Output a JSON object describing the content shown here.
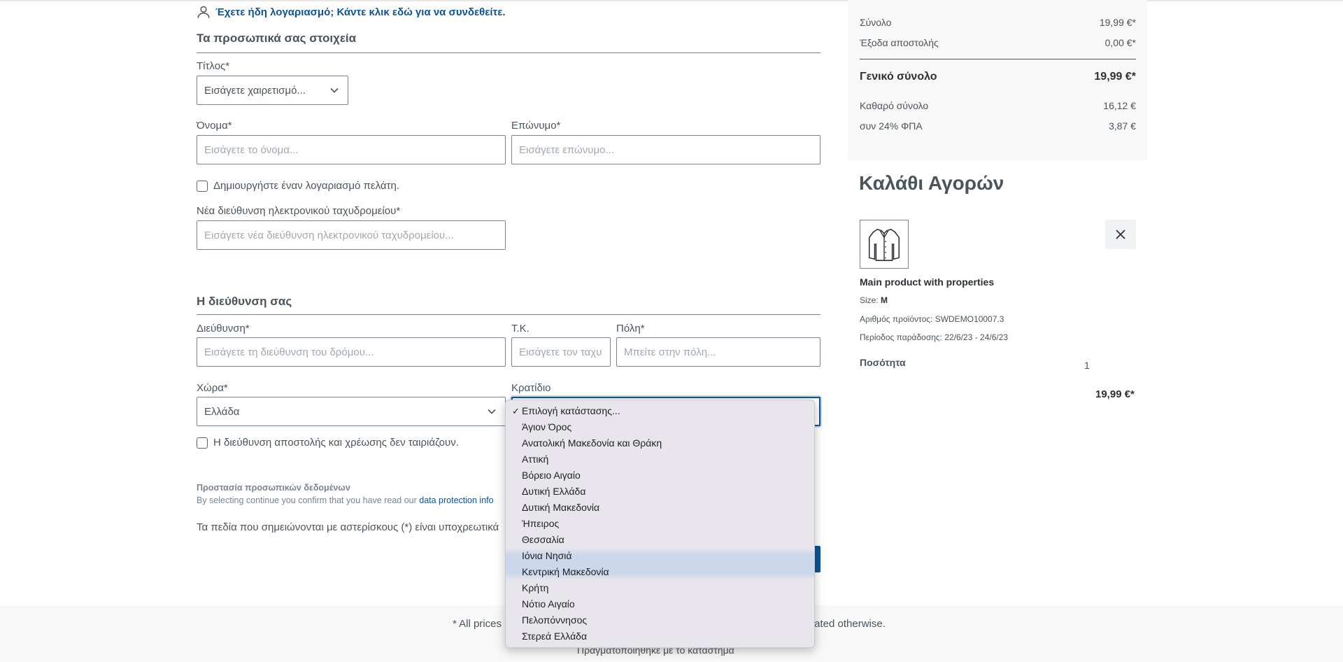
{
  "login_hint": "Έχετε ήδη λογαριασμό; Κάντε κλικ εδώ για να συνδεθείτε.",
  "personal": {
    "heading": "Τα προσωπικά σας στοιχεία",
    "title_label": "Τίτλος*",
    "title_value": "Εισάγετε χαιρετισμό...",
    "first_name_label": "Όνομα*",
    "first_name_placeholder": "Εισάγετε το όνομα...",
    "last_name_label": "Επώνυμο*",
    "last_name_placeholder": "Εισάγετε επώνυμο...",
    "create_account_label": "Δημιουργήστε έναν λογαριασμό πελάτη.",
    "email_label": "Νέα διεύθυνση ηλεκτρονικού ταχυδρομείου*",
    "email_placeholder": "Εισάγετε νέα διεύθυνση ηλεκτρονικού ταχυδρομείου..."
  },
  "address": {
    "heading": "Η διεύθυνση σας",
    "street_label": "Διεύθυνση*",
    "street_placeholder": "Εισάγετε τη διεύθυνση του δρόμου...",
    "zip_label": "Τ.Κ.",
    "zip_placeholder": "Εισάγετε τον ταχυ",
    "city_label": "Πόλη*",
    "city_placeholder": "Μπείτε στην πόλη...",
    "country_label": "Χώρα*",
    "country_value": "Ελλάδα",
    "state_label": "Κρατίδιο",
    "different_shipping_label": "Η διεύθυνση αποστολής και χρέωσης δεν ταιριάζουν."
  },
  "privacy": {
    "title": "Προστασία προσωπικών δεδομένων",
    "text": "By selecting continue you confirm that you have read our ",
    "link": "data protection info",
    "required_note": "Τα πεδία που σημειώνονται με αστερίσκους (*) είναι υποχρεωτικά"
  },
  "state_dropdown": {
    "options": [
      "Επιλογή κατάστασης...",
      "Άγιον Όρος",
      "Ανατολική Μακεδονία και Θράκη",
      "Αττική",
      "Βόρειο Αιγαίο",
      "Δυτική Ελλάδα",
      "Δυτική Μακεδονία",
      "Ήπειρος",
      "Θεσσαλία",
      "Ιόνια Νησιά",
      "Κεντρική Μακεδονία",
      "Κρήτη",
      "Νότιο Αιγαίο",
      "Πελοπόννησος",
      "Στερεά Ελλάδα"
    ],
    "selected_index": 0,
    "highlighted_indices": [
      9,
      10
    ]
  },
  "summary": {
    "subtotal_label": "Σύνολο",
    "subtotal_value": "19,99 €*",
    "shipping_label": "Έξοδα αποστολής",
    "shipping_value": "0,00 €*",
    "grand_total_label": "Γενικό σύνολο",
    "grand_total_value": "19,99 €*",
    "net_label": "Καθαρό σύνολο",
    "net_value": "16,12 €",
    "vat_label": "συν 24% ΦΠΑ",
    "vat_value": "3,87 €"
  },
  "cart": {
    "title": "Καλάθι Αγορών",
    "product_name": "Main product with properties",
    "size_label": "Size: ",
    "size_value": "M",
    "product_number": "Αριθμός προϊόντος: SWDEMO10007.3",
    "delivery_period": "Περίοδος παράδοσης: 22/6/23 - 24/6/23",
    "quantity_label": "Ποσότητα",
    "quantity_value": "1",
    "line_price": "19,99 €*"
  },
  "footer": {
    "prices_left": "* All prices",
    "prices_right": "tated otherwise.",
    "powered": "Πραγματοποιήθηκε με το κατάστημα"
  }
}
